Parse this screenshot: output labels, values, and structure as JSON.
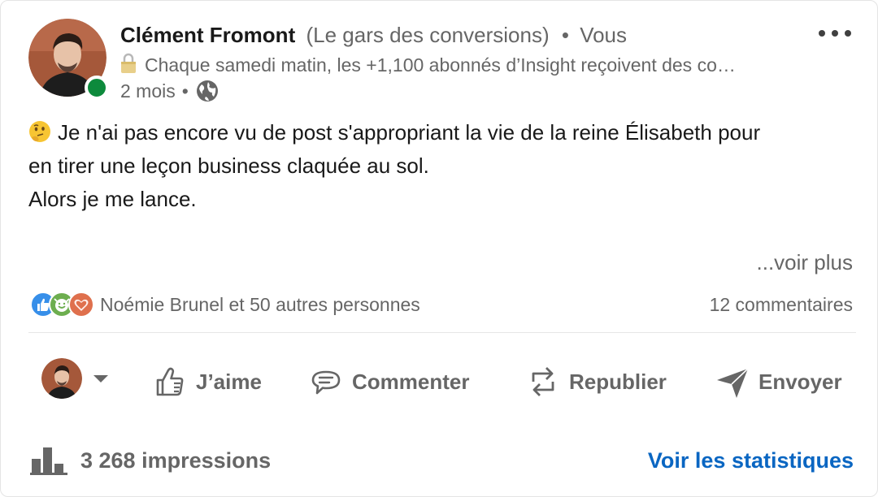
{
  "author": {
    "name": "Clément Fromont",
    "tagline": "(Le gars des conversions)",
    "separator": "•",
    "relation": "Vous",
    "headline": "Chaque samedi matin, les +1,100 abonnés d’Insight reçoivent des co…",
    "time_ago": "2 mois",
    "meta_dot": "•",
    "visibility_icon": "globe-icon",
    "online_color": "#0d8a3c"
  },
  "post": {
    "lines": [
      "Je n'ai pas encore vu de post s'appropriant la vie de la reine Élisabeth pour",
      "en tirer une leçon business claquée au sol.",
      "Alors je me lance."
    ],
    "leading_emoji": "thinking-face-emoji",
    "see_more": "...voir plus"
  },
  "social": {
    "reaction_icons": [
      "like-icon",
      "celebrate-icon",
      "love-icon"
    ],
    "reactions_text": "Noémie Brunel et 50 autres personnes",
    "comments": "12 commentaires"
  },
  "actions": {
    "like": "J’aime",
    "comment": "Commenter",
    "repost": "Republier",
    "send": "Envoyer"
  },
  "footer": {
    "impressions": "3 268 impressions",
    "stats_link": "Voir les statistiques"
  },
  "colors": {
    "accent": "#0a66c2",
    "text_primary": "#191919",
    "text_secondary": "#666666"
  }
}
